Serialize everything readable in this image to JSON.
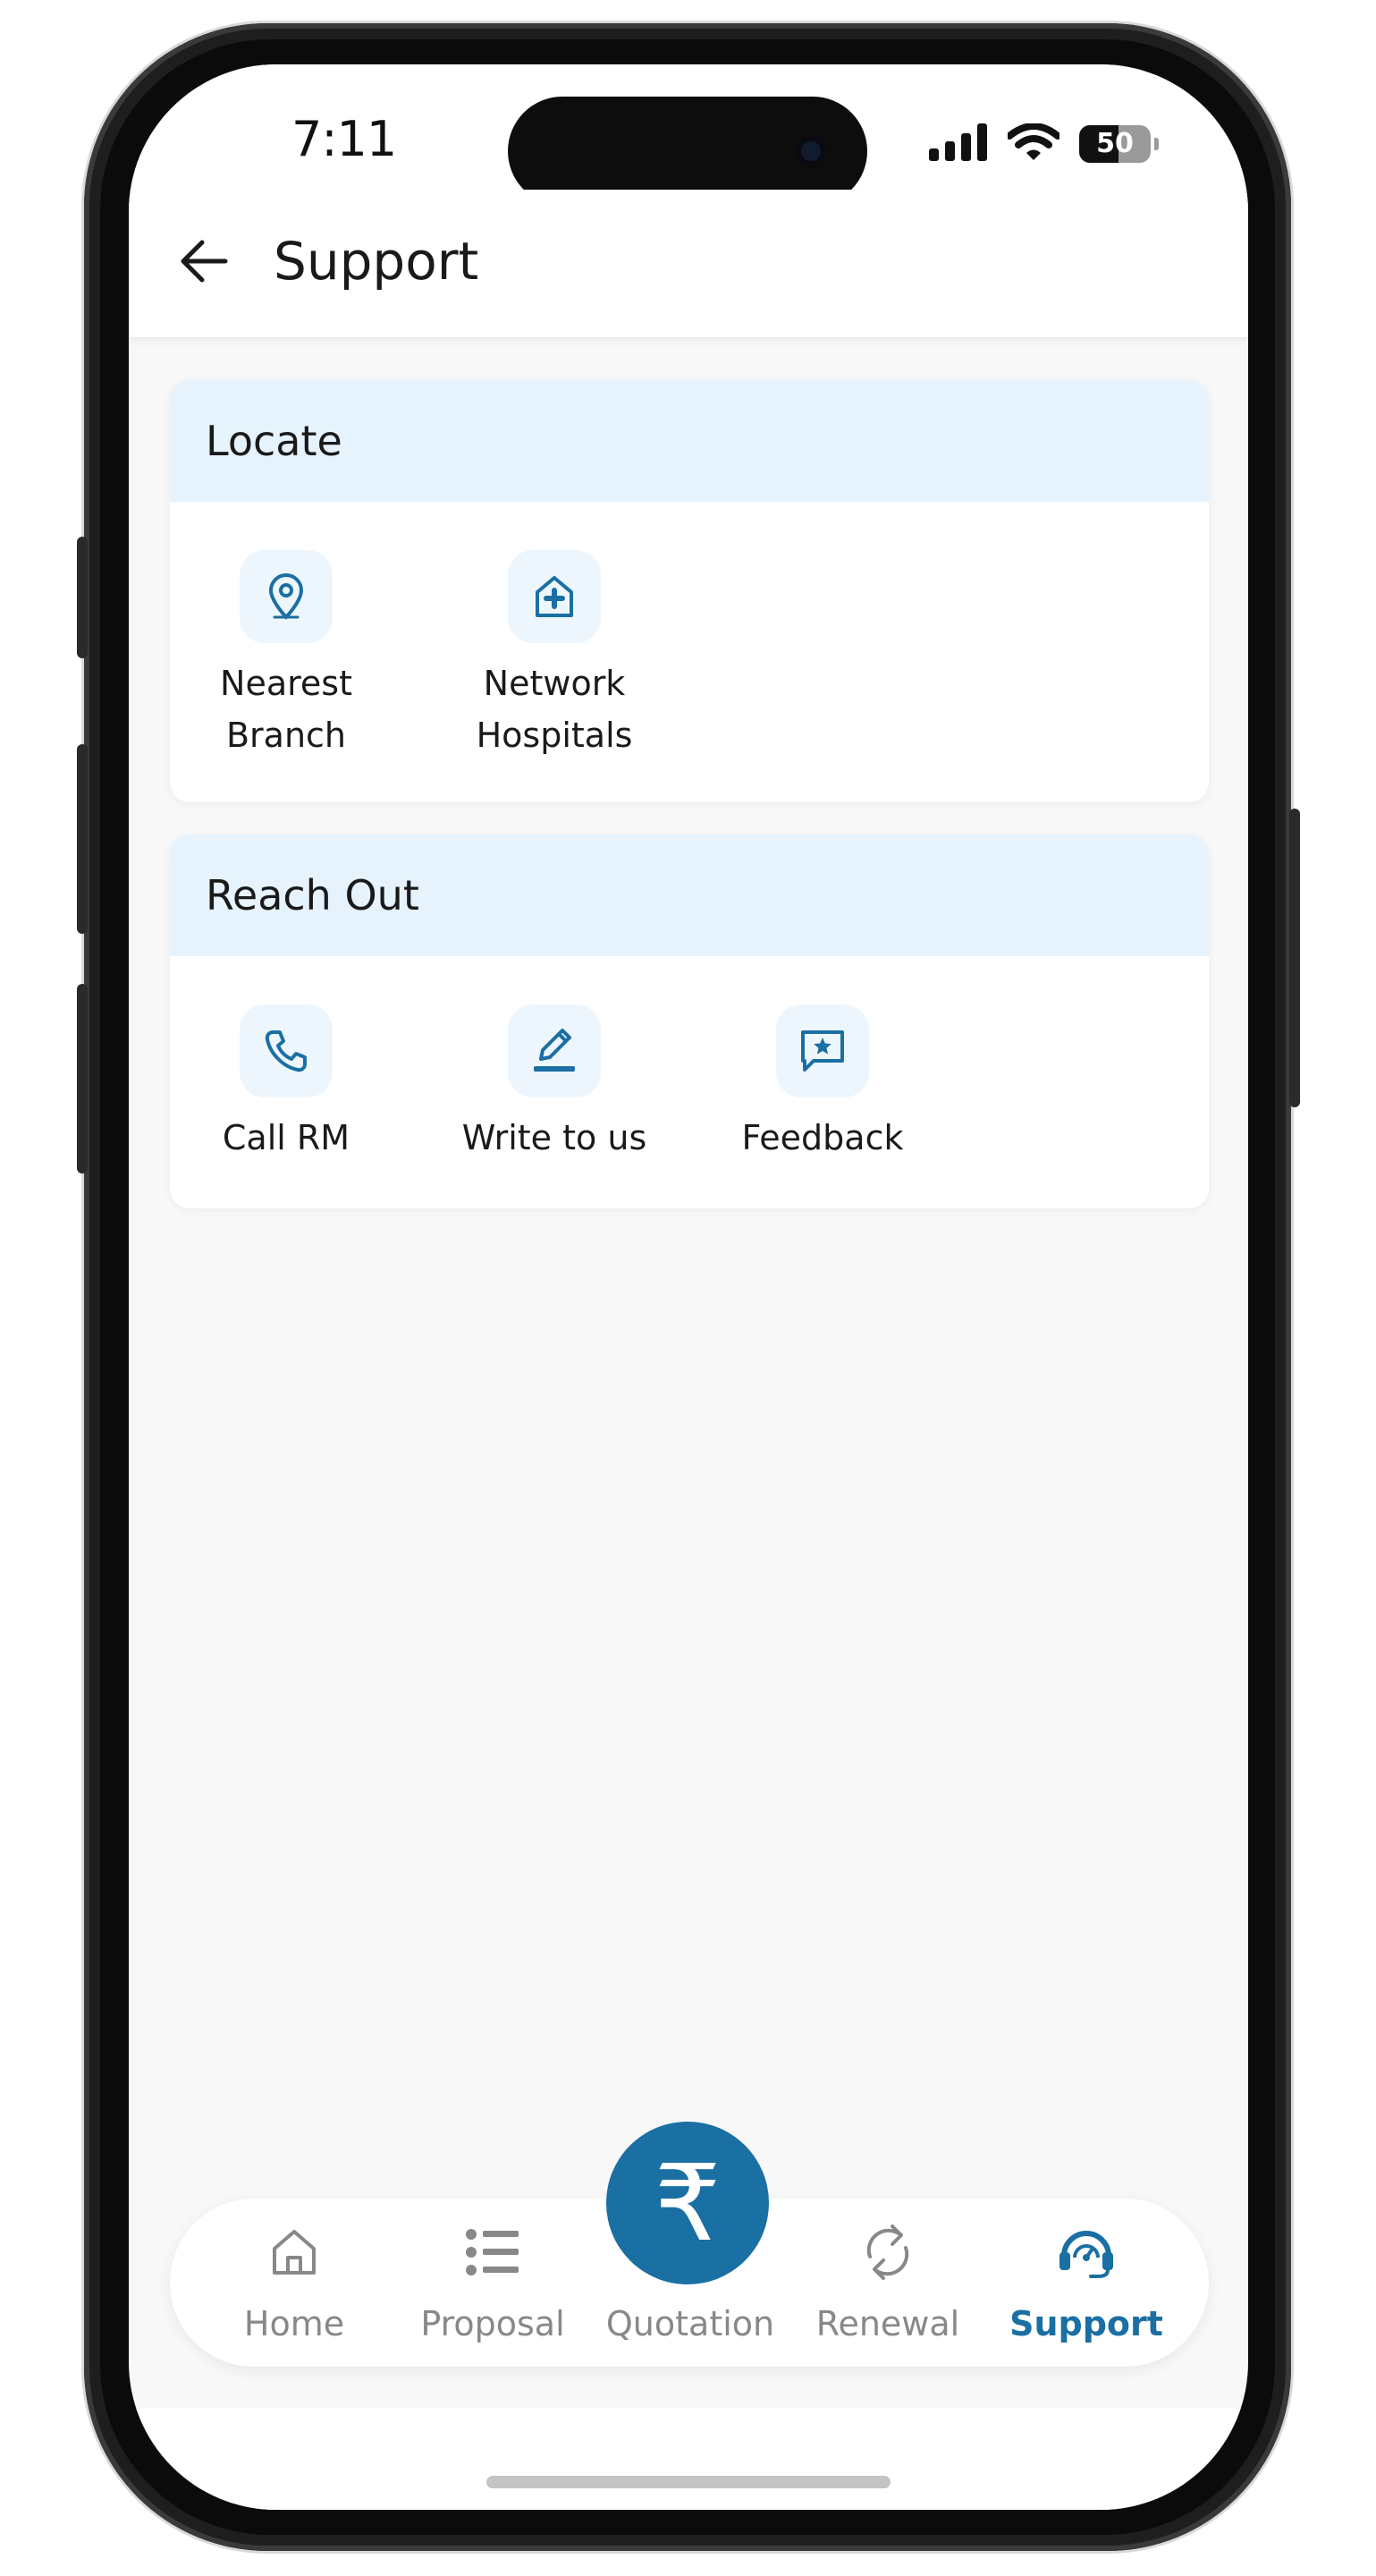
{
  "status_bar": {
    "time": "7:11",
    "battery": "50"
  },
  "header": {
    "title": "Support"
  },
  "locate": {
    "title": "Locate",
    "items": [
      {
        "label_line1": "Nearest",
        "label_line2": "Branch",
        "icon": "location-pin-icon"
      },
      {
        "label_line1": "Network",
        "label_line2": "Hospitals",
        "icon": "hospital-icon"
      }
    ]
  },
  "reach_out": {
    "title": "Reach Out",
    "items": [
      {
        "label": "Call RM",
        "icon": "phone-icon"
      },
      {
        "label": "Write to us",
        "icon": "pencil-icon"
      },
      {
        "label": "Feedback",
        "icon": "feedback-star-icon"
      }
    ]
  },
  "bottom_nav": {
    "items": [
      {
        "label": "Home",
        "icon": "home-icon"
      },
      {
        "label": "Proposal",
        "icon": "list-icon"
      },
      {
        "label": "Quotation",
        "icon": "rupee-icon"
      },
      {
        "label": "Renewal",
        "icon": "refresh-icon"
      },
      {
        "label": "Support",
        "icon": "support-headset-icon"
      }
    ],
    "active": "Support",
    "fab_symbol": "₹"
  },
  "colors": {
    "accent": "#1a6fa3",
    "card_header": "#e6f3fd",
    "icon_bg": "#eef6fd",
    "inactive": "#888888"
  }
}
